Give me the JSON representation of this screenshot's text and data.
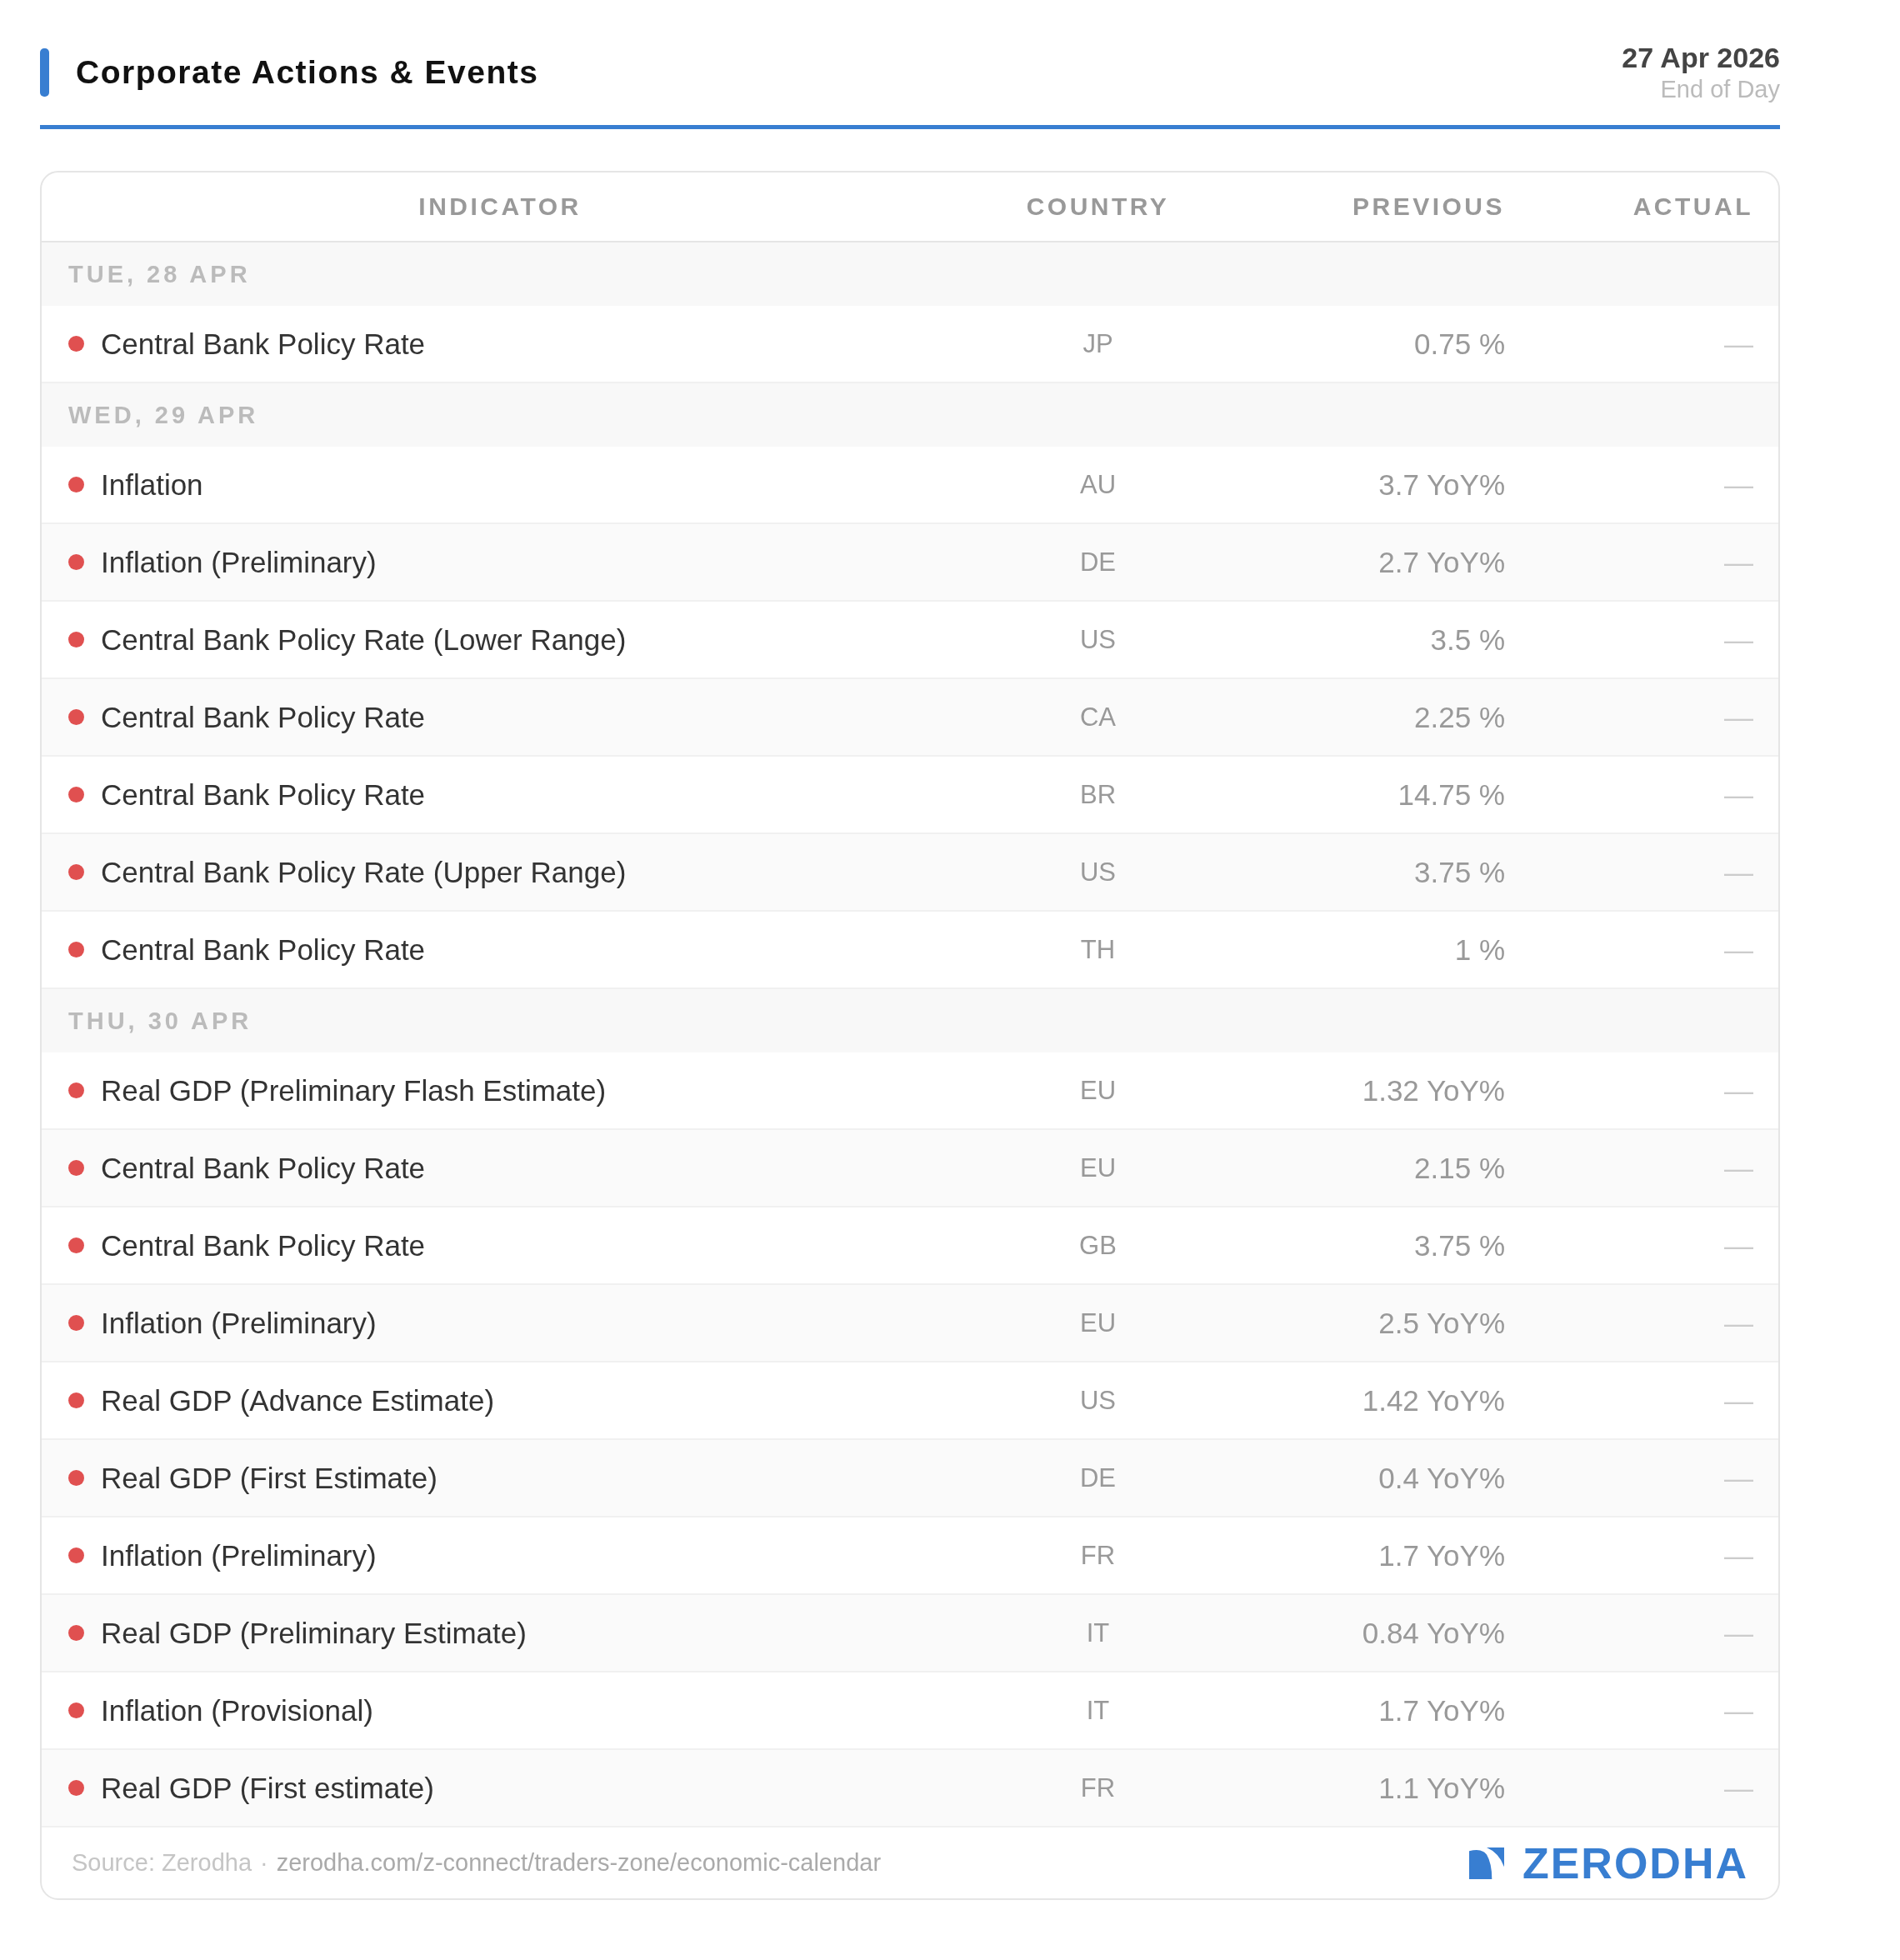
{
  "header": {
    "title": "Corporate Actions & Events",
    "date": "27 Apr 2026",
    "subtitle": "End of Day"
  },
  "table": {
    "columns": [
      "INDICATOR",
      "COUNTRY",
      "PREVIOUS",
      "ACTUAL"
    ],
    "groups": [
      {
        "day": "TUE, 28 APR",
        "rows": [
          {
            "indicator": "Central Bank Policy Rate",
            "country": "JP",
            "previous": "0.75 %",
            "actual": "—"
          }
        ]
      },
      {
        "day": "WED, 29 APR",
        "rows": [
          {
            "indicator": "Inflation",
            "country": "AU",
            "previous": "3.7 YoY%",
            "actual": "—"
          },
          {
            "indicator": "Inflation (Preliminary)",
            "country": "DE",
            "previous": "2.7 YoY%",
            "actual": "—"
          },
          {
            "indicator": "Central Bank Policy Rate (Lower Range)",
            "country": "US",
            "previous": "3.5 %",
            "actual": "—"
          },
          {
            "indicator": "Central Bank Policy Rate",
            "country": "CA",
            "previous": "2.25 %",
            "actual": "—"
          },
          {
            "indicator": "Central Bank Policy Rate",
            "country": "BR",
            "previous": "14.75 %",
            "actual": "—"
          },
          {
            "indicator": "Central Bank Policy Rate (Upper Range)",
            "country": "US",
            "previous": "3.75 %",
            "actual": "—"
          },
          {
            "indicator": "Central Bank Policy Rate",
            "country": "TH",
            "previous": "1 %",
            "actual": "—"
          }
        ]
      },
      {
        "day": "THU, 30 APR",
        "rows": [
          {
            "indicator": "Real GDP (Preliminary Flash Estimate)",
            "country": "EU",
            "previous": "1.32 YoY%",
            "actual": "—"
          },
          {
            "indicator": "Central Bank Policy Rate",
            "country": "EU",
            "previous": "2.15 %",
            "actual": "—"
          },
          {
            "indicator": "Central Bank Policy Rate",
            "country": "GB",
            "previous": "3.75 %",
            "actual": "—"
          },
          {
            "indicator": "Inflation (Preliminary)",
            "country": "EU",
            "previous": "2.5 YoY%",
            "actual": "—"
          },
          {
            "indicator": "Real GDP (Advance Estimate)",
            "country": "US",
            "previous": "1.42 YoY%",
            "actual": "—"
          },
          {
            "indicator": "Real GDP (First Estimate)",
            "country": "DE",
            "previous": "0.4 YoY%",
            "actual": "—"
          },
          {
            "indicator": "Inflation (Preliminary)",
            "country": "FR",
            "previous": "1.7 YoY%",
            "actual": "—"
          },
          {
            "indicator": "Real GDP (Preliminary Estimate)",
            "country": "IT",
            "previous": "0.84 YoY%",
            "actual": "—"
          },
          {
            "indicator": "Inflation (Provisional)",
            "country": "IT",
            "previous": "1.7 YoY%",
            "actual": "—"
          },
          {
            "indicator": "Real GDP (First estimate)",
            "country": "FR",
            "previous": "1.1 YoY%",
            "actual": "—"
          }
        ]
      }
    ]
  },
  "footer": {
    "source": "Source: Zerodha",
    "separator": "·",
    "link": "zerodha.com/z-connect/traders-zone/economic-calendar",
    "logo": "ZERODHA"
  }
}
